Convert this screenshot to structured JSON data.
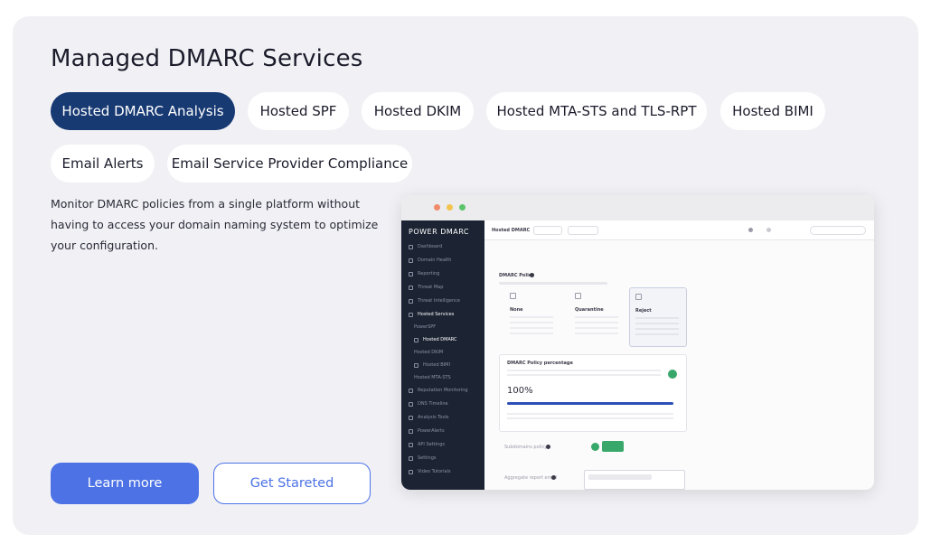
{
  "heading": "Managed DMARC Services",
  "tabs": [
    {
      "label": "Hosted DMARC Analysis",
      "active": true
    },
    {
      "label": "Hosted SPF",
      "active": false
    },
    {
      "label": "Hosted DKIM",
      "active": false
    },
    {
      "label": "Hosted MTA-STS and TLS-RPT",
      "active": false
    },
    {
      "label": "Hosted BIMI",
      "active": false
    },
    {
      "label": "Email Alerts",
      "active": false
    },
    {
      "label": "Email Service Provider Compliance",
      "active": false
    }
  ],
  "description": "Monitor DMARC policies from a single platform without having to access your domain naming system to optimize your configuration.",
  "buttons": {
    "learn_more": "Learn more",
    "get_started": "Get Stareted"
  },
  "colors": {
    "card_bg": "#f1f1f5",
    "active_tab": "#173a73",
    "primary": "#4c72e6",
    "sidebar": "#1c2433",
    "success": "#37a86a"
  },
  "mockup": {
    "logo": "POWER DMARC",
    "header_title": "Hosted DMARC",
    "sidebar": [
      {
        "label": "Dashboard"
      },
      {
        "label": "Domain Health"
      },
      {
        "label": "Reporting"
      },
      {
        "label": "Threat Map"
      },
      {
        "label": "Threat Intelligence"
      },
      {
        "label": "Hosted Services"
      },
      {
        "label": "PowerSPF"
      },
      {
        "label": "Hosted DMARC"
      },
      {
        "label": "Hosted DKIM"
      },
      {
        "label": "Hosted BIMI"
      },
      {
        "label": "Hosted MTA-STS"
      },
      {
        "label": "Reputation Monitoring"
      },
      {
        "label": "DNS Timeline"
      },
      {
        "label": "Analysis Tools"
      },
      {
        "label": "PowerAlerts"
      },
      {
        "label": "API Settings"
      },
      {
        "label": "Settings"
      },
      {
        "label": "Video Tutorials"
      }
    ],
    "policy_title": "DMARC Policy",
    "policy_options": [
      "None",
      "Quarantine",
      "Reject"
    ],
    "percentage_title": "DMARC Policy percentage",
    "percentage_value": "100%",
    "percentage_fill": 1.0,
    "subdomain_label": "Subdomains policy",
    "aggregate_label": "Aggregate report email"
  }
}
